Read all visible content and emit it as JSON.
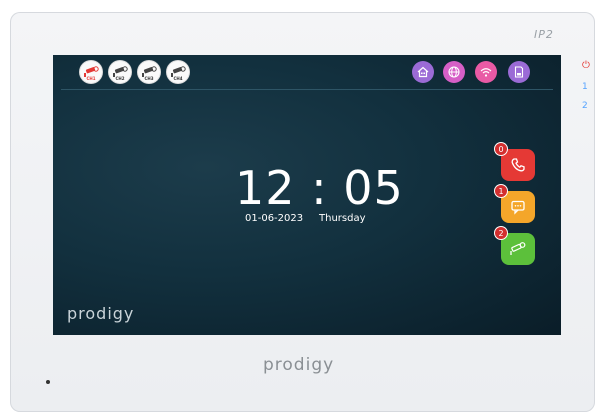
{
  "device": {
    "model": "IP2",
    "side_indicators": [
      "1",
      "2"
    ],
    "brand": "prodigy"
  },
  "screen": {
    "cameras": [
      {
        "label": "CH1",
        "active": true
      },
      {
        "label": "CH2",
        "active": false
      },
      {
        "label": "CH3",
        "active": false
      },
      {
        "label": "CH4",
        "active": false
      }
    ],
    "status_icons": [
      {
        "name": "home-icon",
        "color": "#9b6bd6"
      },
      {
        "name": "globe-icon",
        "color": "#d65fc6"
      },
      {
        "name": "wifi-icon",
        "color": "#e95aa5"
      },
      {
        "name": "sd-card-icon",
        "color": "#9b6bd6"
      }
    ],
    "time": "12 : 05",
    "date": "01-06-2023",
    "day": "Thursday",
    "quick_buttons": [
      {
        "name": "call",
        "badge": "0",
        "color": "#e53935"
      },
      {
        "name": "message",
        "badge": "1",
        "color": "#f4a62a"
      },
      {
        "name": "monitor",
        "badge": "2",
        "color": "#5cc03b"
      }
    ],
    "brand": "prodigy"
  }
}
